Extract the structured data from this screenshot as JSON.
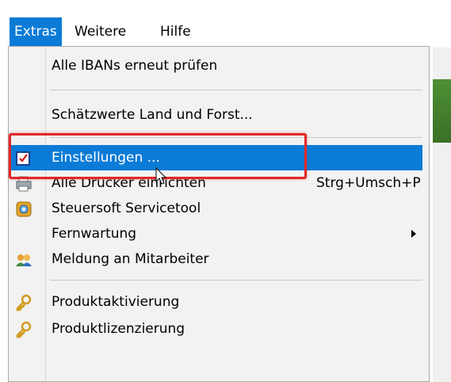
{
  "menubar": {
    "items": [
      "Extras",
      "Weitere",
      "Hilfe"
    ]
  },
  "menu": {
    "items": [
      {
        "label": "Alle IBANs erneut prüfen"
      },
      {
        "label": "Schätzwerte Land und Forst..."
      },
      {
        "label": "Einstellungen ...",
        "icon": "settings-checklist-icon",
        "highlighted": true
      },
      {
        "label": "Alle Drucker einrichten",
        "shortcut": "Strg+Umsch+P",
        "icon": "printer-icon"
      },
      {
        "label": "Steuersoft Servicetool",
        "icon": "service-tool-icon"
      },
      {
        "label": "Fernwartung",
        "submenu": true
      },
      {
        "label": "Meldung an Mitarbeiter",
        "icon": "users-icon"
      },
      {
        "label": "Produktaktivierung",
        "icon": "key-icon"
      },
      {
        "label": "Produktlizenzierung",
        "icon": "key-icon"
      }
    ]
  },
  "colors": {
    "highlight": "#0a7bd6",
    "annotation": "#e0282a",
    "menu_bg": "#f2f2f2",
    "app_accent": "#4f8f34"
  }
}
